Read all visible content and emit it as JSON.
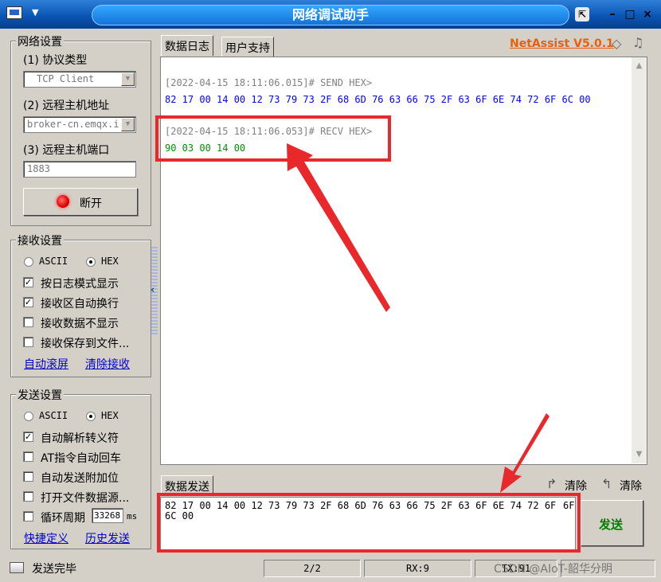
{
  "window": {
    "title": "网络调试助手",
    "menu_arrow": "▼",
    "pin_icon": "pin-icon",
    "min_symbol": "–",
    "max_symbol": "□",
    "close_symbol": "×"
  },
  "net_settings": {
    "title": "网络设置",
    "protocol_label": "(1) 协议类型",
    "protocol_value": "TCP Client",
    "host_label": "(2) 远程主机地址",
    "host_value": "broker-cn.emqx.i",
    "port_label": "(3) 远程主机端口",
    "port_value": "1883",
    "connect_button": "断开"
  },
  "recv_settings": {
    "title": "接收设置",
    "ascii": "ASCII",
    "hex": "HEX",
    "options": [
      "按日志模式显示",
      "接收区自动换行",
      "接收数据不显示",
      "接收保存到文件..."
    ],
    "checked": [
      true,
      true,
      false,
      false
    ],
    "link_autoscroll": "自动滚屏",
    "link_clear": "清除接收"
  },
  "send_settings": {
    "title": "发送设置",
    "ascii": "ASCII",
    "hex": "HEX",
    "options": [
      "自动解析转义符",
      "AT指令自动回车",
      "自动发送附加位",
      "打开文件数据源...",
      "循环周期"
    ],
    "checked": [
      true,
      false,
      false,
      false,
      false
    ],
    "period_value": "33268",
    "period_unit": "ms",
    "link_shortcut": "快捷定义",
    "link_history": "历史发送"
  },
  "tabs": {
    "log": "数据日志",
    "user": "用户支持",
    "brand": "NetAssist V5.0.1"
  },
  "log": {
    "entries": [
      {
        "header": "[2022-04-15 18:11:06.015]# SEND HEX>",
        "data": "82 17 00 14 00 12 73 79 73 2F 68 6D 76 63 66 75 2F 63 6F 6E 74 72 6F 6C 00",
        "kind": "send"
      },
      {
        "header": "[2022-04-15 18:11:06.053]# RECV HEX>",
        "data": "90 03 00 14 00",
        "kind": "recv"
      }
    ]
  },
  "send_panel": {
    "tab": "数据发送",
    "clear1": "清除",
    "clear2": "清除",
    "text_line1": "82 17 00 14 00 12 73 79 73 2F 68 6D 76 63 66 75 2F 63 6F 6E 74 72 6F 6C 00",
    "text_line1a": "82 17 00 14 00 12 73 79 73 2F 68 6D 76 63 66 75 2F 63 6F 6E 74 72 6F",
    "text_line2": "6C 00",
    "send_button": "发送"
  },
  "status": {
    "message": "发送完毕",
    "counter": "2/2",
    "rx": "RX:9",
    "tx": "TX:91",
    "watermark": "CSDN @AIoT-韶华分明"
  },
  "colors": {
    "accent_red": "#e8282b",
    "send_blue": "#0000ff",
    "recv_green": "#009000",
    "brand_orange": "#e8600c"
  }
}
